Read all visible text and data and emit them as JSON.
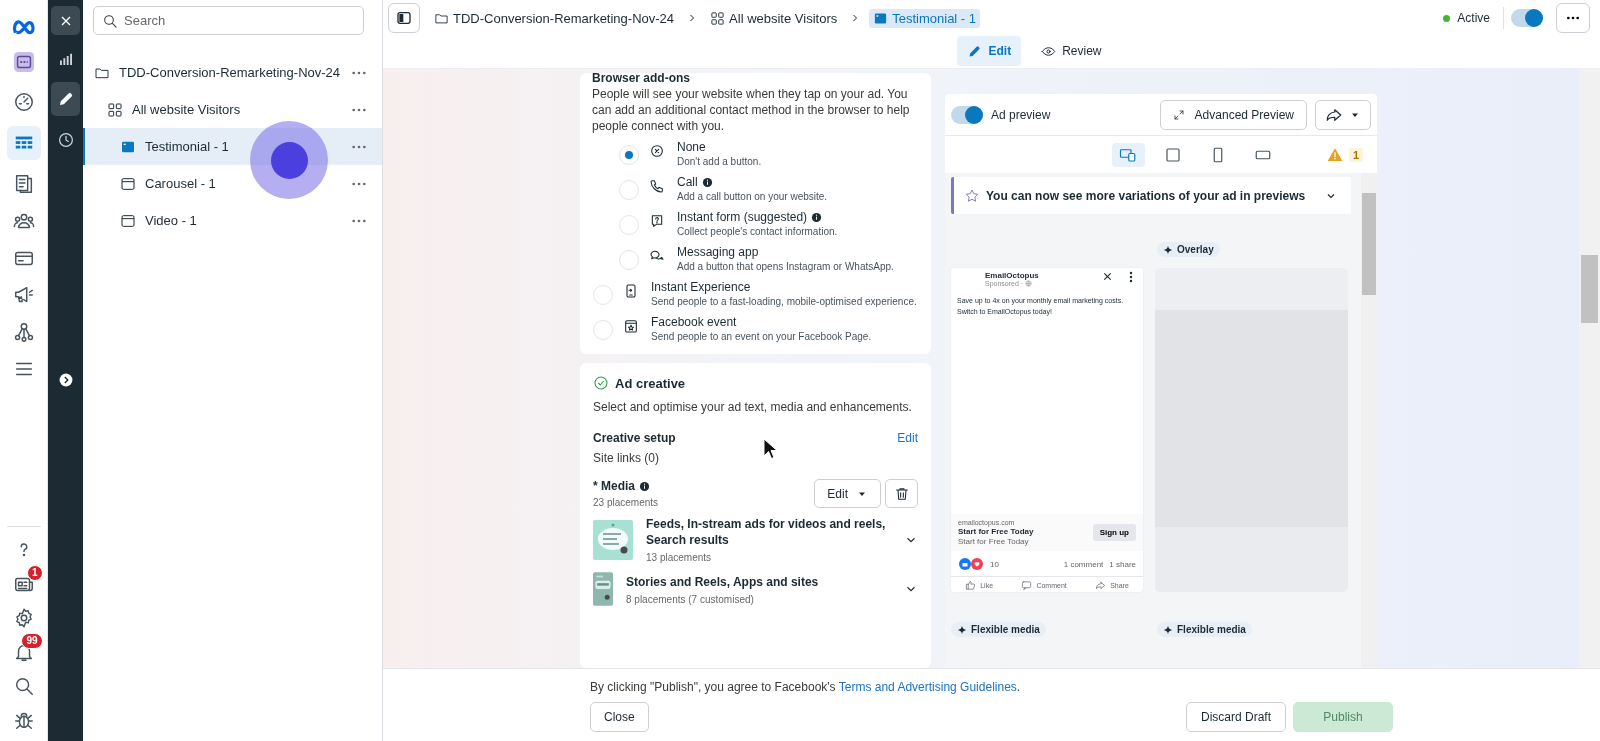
{
  "app_rail": {
    "top_items": [
      {
        "kind": "gauge",
        "selected": false
      },
      {
        "kind": "table",
        "selected": true
      },
      {
        "kind": "pages",
        "selected": false
      },
      {
        "kind": "people",
        "selected": false
      },
      {
        "kind": "card",
        "selected": false
      },
      {
        "kind": "megaphone",
        "selected": false
      },
      {
        "kind": "hierarchy",
        "selected": false
      },
      {
        "kind": "menu",
        "selected": false
      }
    ],
    "bottom_items": [
      {
        "kind": "help",
        "selected": false
      },
      {
        "kind": "news",
        "selected": false,
        "badge": "1"
      },
      {
        "kind": "settings",
        "selected": false
      },
      {
        "kind": "bell",
        "selected": false,
        "badge": "99"
      },
      {
        "kind": "search",
        "selected": false
      },
      {
        "kind": "bug",
        "selected": false
      }
    ]
  },
  "tool_rail": {
    "items": [
      {
        "kind": "chart",
        "selected": false
      },
      {
        "kind": "edit",
        "selected": true
      },
      {
        "kind": "history",
        "selected": false
      }
    ]
  },
  "tree": {
    "search": {
      "placeholder": "Search"
    },
    "nodes": [
      {
        "kind": "campaign",
        "label": "TDD-Conversion-Remarketing-Nov-24",
        "selected": false,
        "children": [
          {
            "kind": "adset",
            "label": "All website Visitors",
            "selected": false,
            "children": [
              {
                "kind": "ad",
                "label": "Testimonial - 1",
                "selected": true
              },
              {
                "kind": "ad",
                "label": "Carousel - 1",
                "selected": false
              },
              {
                "kind": "ad",
                "label": "Video - 1",
                "selected": false
              }
            ]
          }
        ]
      }
    ]
  },
  "breadcrumb": [
    {
      "kind": "campaign",
      "label": "TDD-Conversion-Remarketing-Nov-24",
      "selected": false
    },
    {
      "kind": "adset",
      "label": "All website Visitors",
      "selected": false
    },
    {
      "kind": "ad",
      "label": "Testimonial - 1",
      "selected": true
    }
  ],
  "status": {
    "label": "Active",
    "color": "#42b72a",
    "on": true
  },
  "mode_tabs": [
    {
      "kind": "edit",
      "label": "Edit",
      "selected": true
    },
    {
      "kind": "review",
      "label": "Review",
      "selected": false
    }
  ],
  "browser_addons": {
    "title": "Browser add-ons",
    "description": "People will see your website when they tap on your ad. You can add an additional contact method in the browser to help people connect with you.",
    "options": [
      {
        "kind": "none",
        "label": "None",
        "detail": "Don't add a button.",
        "info": false,
        "selected": true
      },
      {
        "kind": "call",
        "label": "Call",
        "detail": "Add a call button on your website.",
        "info": true,
        "selected": false
      },
      {
        "kind": "form",
        "label": "Instant form (suggested)",
        "detail": "Collect people's contact information.",
        "info": true,
        "selected": false
      },
      {
        "kind": "messaging",
        "label": "Messaging app",
        "detail": "Add a button that opens Instagram or WhatsApp.",
        "info": false,
        "selected": false
      },
      {
        "kind": "experience",
        "label": "Instant Experience",
        "detail": "Send people to a fast-loading, mobile-optimised experience.",
        "info": false,
        "selected": false
      },
      {
        "kind": "event",
        "label": "Facebook event",
        "detail": "Send people to an event on your Facebook Page.",
        "info": false,
        "selected": false
      }
    ]
  },
  "ad_creative": {
    "title": "Ad creative",
    "complete": true,
    "description": "Select and optimise your ad text, media and enhancements.",
    "setup": {
      "title": "Creative setup",
      "edit": "Edit",
      "site_links": "Site links (0)"
    },
    "media": {
      "label": "* Media",
      "info": true,
      "placements": "23 placements",
      "edit": "Edit",
      "groups": [
        {
          "kind": "feed",
          "title": "Feeds, In-stream ads for videos and reels, Search results",
          "placements": "13 placements"
        },
        {
          "kind": "story",
          "title": "Stories and Reels, Apps and sites",
          "placements": "8 placements (7 customised)"
        }
      ]
    }
  },
  "preview": {
    "toggle": {
      "label": "Ad preview",
      "on": true
    },
    "advanced": "Advanced Preview",
    "devices": [
      {
        "kind": "multi",
        "selected": true
      },
      {
        "kind": "square",
        "selected": false
      },
      {
        "kind": "portrait",
        "selected": false
      },
      {
        "kind": "landscape",
        "selected": false
      }
    ],
    "warnings": "1",
    "banner": "You can now see more variations of your ad in previews",
    "chip": "Overlay",
    "ad": {
      "page": "EmailOctopus",
      "sponsored": "Sponsored ·",
      "text": [
        "Save up to 4x on your monthly email marketing costs.",
        "Switch to EmailOctopus today!"
      ],
      "domain": "emailoctopus.com",
      "headline": "Start for Free Today",
      "link_description": "Start for Free Today",
      "cta": "Sign up",
      "reactions": "10",
      "comments": "1 comment",
      "shares": "1 share",
      "actions": [
        {
          "kind": "like",
          "label": "Like"
        },
        {
          "kind": "comment",
          "label": "Comment"
        },
        {
          "kind": "share",
          "label": "Share"
        }
      ]
    },
    "bottom_chips": [
      "Flexible media",
      "Flexible media"
    ]
  },
  "footer": {
    "notice": "By clicking \"Publish\", you agree to Facebook's ",
    "link": "Terms and Advertising Guidelines",
    "end": ".",
    "close": "Close",
    "discard": "Discard Draft",
    "publish": {
      "label": "Publish",
      "disabled": true
    }
  }
}
